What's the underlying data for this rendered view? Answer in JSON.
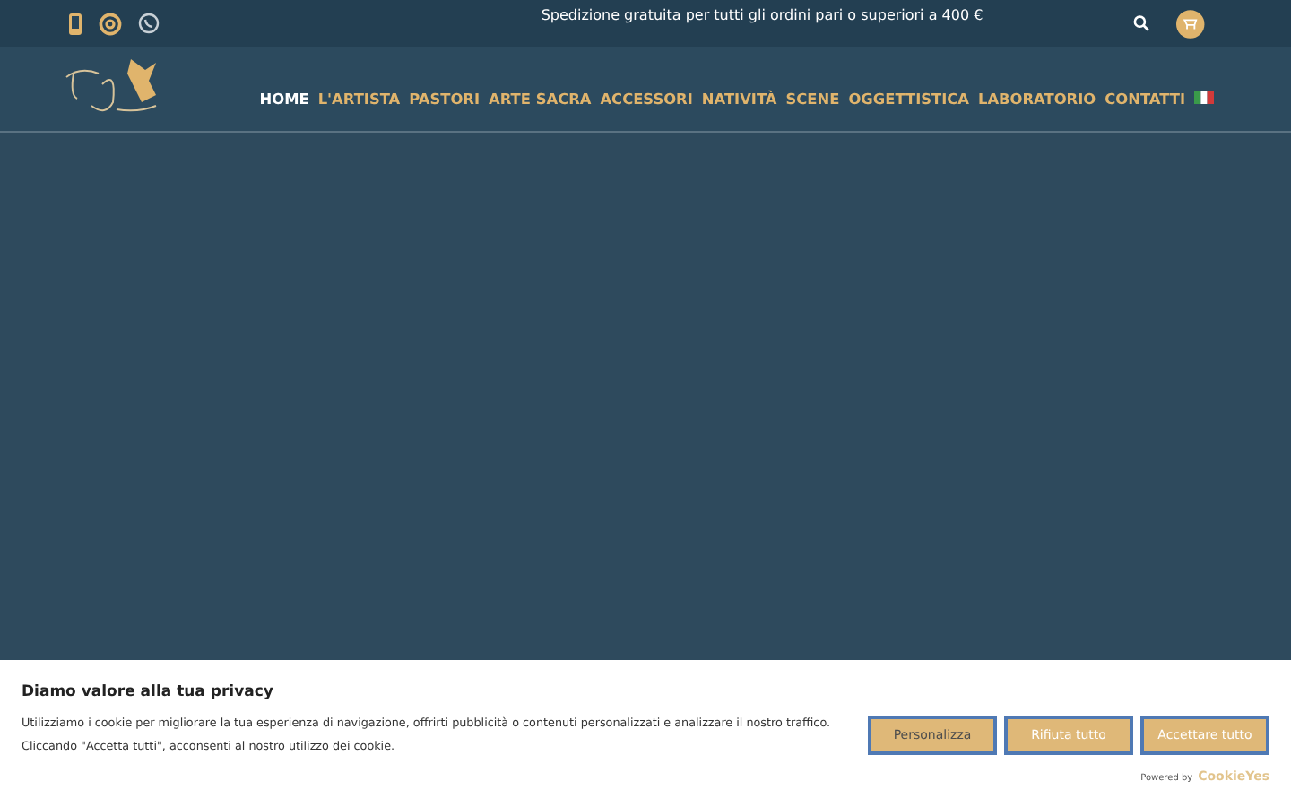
{
  "top_bar": {
    "announcement": "Spedizione gratuita per tutti gli ordini pari o superiori a 400 €"
  },
  "nav": [
    {
      "label": "HOME",
      "selected": true
    },
    {
      "label": "L'ARTISTA",
      "selected": false
    },
    {
      "label": "PASTORI",
      "selected": false
    },
    {
      "label": "ARTE SACRA",
      "selected": false
    },
    {
      "label": "ACCESSORI",
      "selected": false
    },
    {
      "label": "NATIVITÀ",
      "selected": false
    },
    {
      "label": "SCENE",
      "selected": false
    },
    {
      "label": "OGGETTISTICA",
      "selected": false
    },
    {
      "label": "LABORATORIO",
      "selected": false
    },
    {
      "label": "CONTATTI",
      "selected": false
    }
  ],
  "cookie_banner": {
    "title": "Diamo valore alla tua privacy",
    "text": "Utilizziamo i cookie per migliorare la tua esperienza di navigazione, offrirti pubblicità o contenuti personalizzati e analizzare il nostro traffico. Cliccando \"Accetta tutti\", acconsenti al nostro utilizzo dei cookie.",
    "buttons": [
      "Personalizza",
      "Rifiuta tutto",
      "Accettare tutto"
    ],
    "powered_by": "Powered by",
    "brand": "CookieYes"
  }
}
